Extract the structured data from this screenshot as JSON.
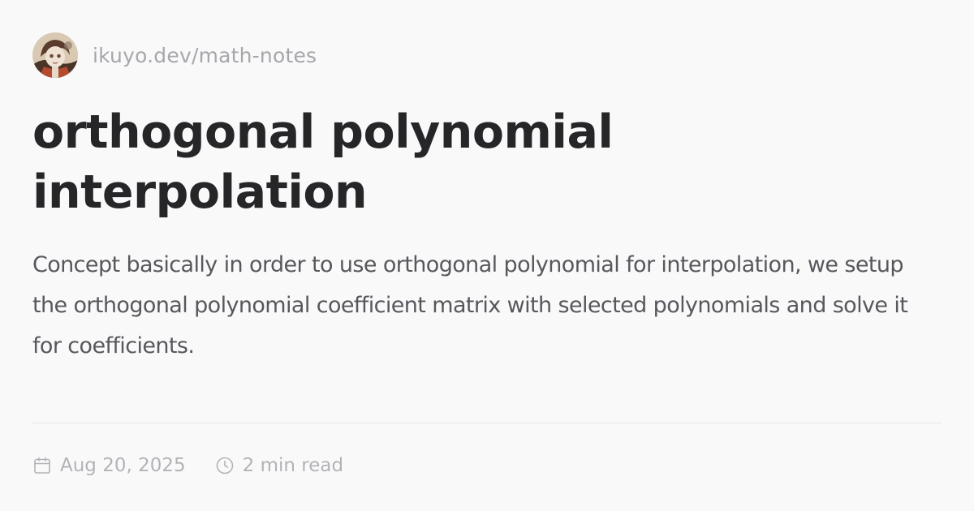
{
  "site": {
    "url": "ikuyo.dev/math-notes",
    "avatar_icon": "avatar-icon"
  },
  "post": {
    "title_line1": "orthogonal polynomial",
    "title_line2": "interpolation",
    "description": "Concept basically in order to use orthogonal polynomial for interpolation, we setup the orthogonal polynomial coefficient matrix with selected polynomials and solve it for coefficients."
  },
  "meta": {
    "date": "Aug 20, 2025",
    "date_icon": "calendar-icon",
    "read_time": "2 min read",
    "read_time_icon": "clock-icon"
  },
  "colors": {
    "background": "#faf9fa",
    "title": "#262528",
    "description": "#58575c",
    "muted": "#a7a6ab",
    "divider": "#e6e5e8"
  }
}
